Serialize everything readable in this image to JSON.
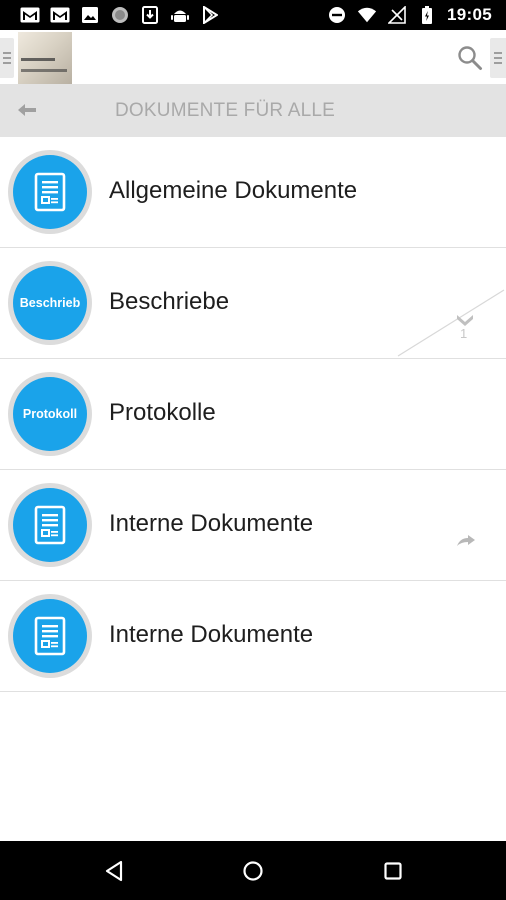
{
  "status_bar": {
    "time": "19:05",
    "left_icons": [
      "gmail-icon",
      "gmail-icon",
      "image-icon",
      "circle-icon",
      "download-icon",
      "android-icon",
      "play-store-icon"
    ],
    "right_icons": [
      "do-not-disturb-icon",
      "wifi-icon",
      "no-signal-icon",
      "battery-icon"
    ]
  },
  "toolbar": {
    "menu_left_icon": "hamburger-icon",
    "logo_icon": "app-logo",
    "search_icon": "search-icon",
    "menu_right_icon": "hamburger-icon"
  },
  "subheader": {
    "back_icon": "back-arrow-icon",
    "title": "DOKUMENTE FÜR ALLE"
  },
  "list": [
    {
      "label": "Allgemeine Dokumente",
      "icon": "document-icon",
      "avatar_text": ""
    },
    {
      "label": "Beschriebe",
      "icon": "",
      "avatar_text": "Beschrieb",
      "badge_count": "1",
      "badge_icon": "chevron-down-icon"
    },
    {
      "label": "Protokolle",
      "icon": "",
      "avatar_text": "Protokoll"
    },
    {
      "label": "Interne Dokumente",
      "icon": "document-icon",
      "avatar_text": "",
      "action_icon": "share-arrow-icon"
    },
    {
      "label": "Interne Dokumente",
      "icon": "document-icon",
      "avatar_text": ""
    }
  ],
  "nav_bar": {
    "back_icon": "nav-back-icon",
    "home_icon": "nav-home-icon",
    "recents_icon": "nav-recents-icon"
  },
  "colors": {
    "accent": "#1aa3ea",
    "subheader_bg": "#e3e3e3",
    "subheader_text": "#a9a9a9",
    "status_bar": "#000000"
  }
}
